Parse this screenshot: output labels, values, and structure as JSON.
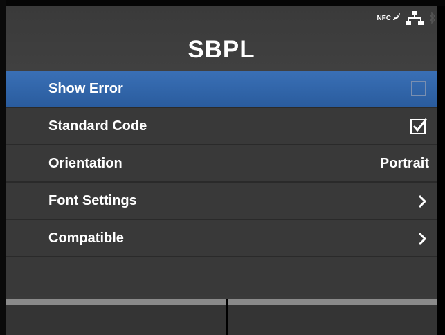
{
  "header": {
    "title": "SBPL",
    "status_icons": {
      "nfc_label": "NFC",
      "network": "network-icon",
      "bluetooth": "bluetooth-icon"
    }
  },
  "menu": {
    "items": [
      {
        "label": "Show Error",
        "control": "checkbox",
        "checked": false,
        "selected": true
      },
      {
        "label": "Standard Code",
        "control": "checkbox",
        "checked": true,
        "selected": false
      },
      {
        "label": "Orientation",
        "control": "value",
        "value": "Portrait",
        "selected": false
      },
      {
        "label": "Font Settings",
        "control": "submenu",
        "icon": "chevron-right-icon",
        "selected": false
      },
      {
        "label": "Compatible",
        "control": "submenu",
        "icon": "chevron-right-icon",
        "selected": false
      }
    ]
  },
  "softkeys": {
    "left_label": "",
    "right_label": ""
  },
  "colors": {
    "background": "#3a3a3a",
    "selected_row": "#3a70b6",
    "text": "#ffffff",
    "softkey_line": "#8a8a8a"
  }
}
